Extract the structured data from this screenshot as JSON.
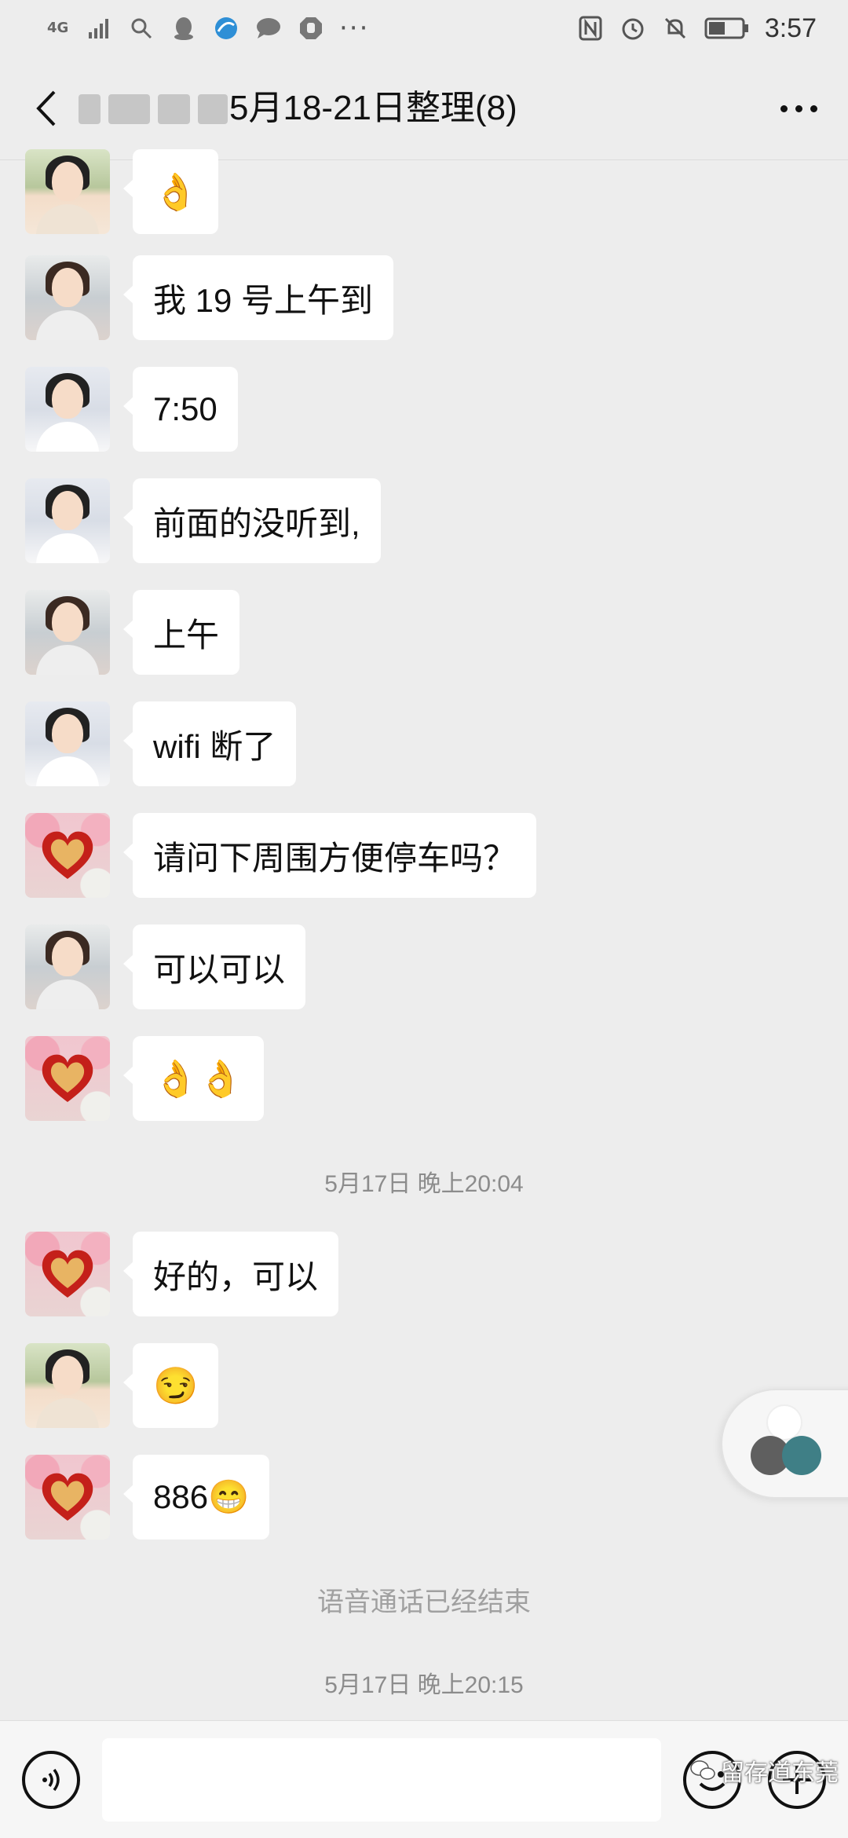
{
  "status_bar": {
    "network": "4G",
    "time": "3:57",
    "overflow_dots": "···"
  },
  "header": {
    "title": "5月18-21日整理(8)"
  },
  "messages": [
    {
      "avatar": "glasses-woman-avatar",
      "content": "👌",
      "type": "emoji"
    },
    {
      "avatar": "street-woman-avatar",
      "content": "我 19 号上午到",
      "type": "text"
    },
    {
      "avatar": "white-shirt-woman-avatar",
      "content": "7:50",
      "type": "text"
    },
    {
      "avatar": "white-shirt-woman-avatar",
      "content": "前面的没听到,",
      "type": "text"
    },
    {
      "avatar": "street-woman-avatar",
      "content": "上午",
      "type": "text"
    },
    {
      "avatar": "white-shirt-woman-avatar",
      "content": "wifi 断了",
      "type": "text"
    },
    {
      "avatar": "heart-avatar",
      "content": "请问下周围方便停车吗？",
      "type": "text"
    },
    {
      "avatar": "street-woman-avatar",
      "content": "可以可以",
      "type": "text"
    },
    {
      "avatar": "heart-avatar",
      "content": "👌👌",
      "type": "emoji"
    },
    {
      "avatar": "heart-avatar",
      "content": "好的，可以",
      "type": "text"
    },
    {
      "avatar": "glasses-woman-avatar",
      "content": "😏",
      "type": "emoji"
    },
    {
      "avatar": "heart-avatar",
      "content": "886😁",
      "type": "text"
    }
  ],
  "timestamps": [
    "5月17日 晚上20:04",
    "5月17日 晚上20:15"
  ],
  "system_note": "语音通话已经结束",
  "watermark": "留存道东莞",
  "colors": {
    "background": "#ededed",
    "bubble": "#ffffff",
    "timestamp_text": "#8c8c8c"
  },
  "icons": [
    "back-chevron-icon",
    "more-dots-icon",
    "voice-icon",
    "emoji-icon",
    "plus-icon"
  ]
}
